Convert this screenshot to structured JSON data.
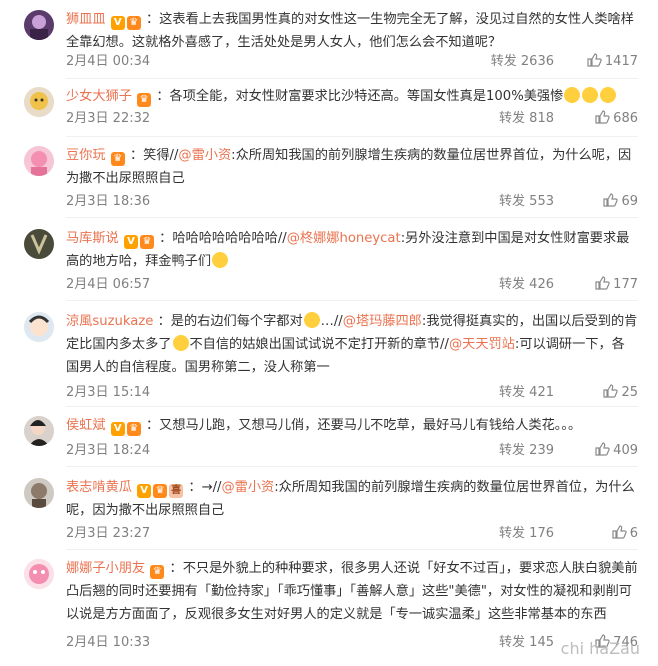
{
  "comments": [
    {
      "user": "狮皿皿",
      "text": "：这表看上去我国男性真的对女性这一生物完全无了解，没见过自然的女性人类啥样 全靠幻想。这就格外喜感了，生活处处是男人女人，他们怎么会不知道呢？",
      "time": "2月4日 00:34",
      "share": "转发 2636",
      "likes": "1417"
    },
    {
      "user": "少女大狮子",
      "text": "：各项全能，对女性财富要求比沙特还高。等国女性真是100%美强惨",
      "time": "2月3日 22:32",
      "share": "转发 818",
      "likes": "686"
    },
    {
      "user": "豆你玩",
      "text_a": "：笑得//",
      "mention_1": "@雷小资",
      "text_b": ":众所周知我国的前列腺增生疾病的数量位居世界首位，为什么呢，因为撒不出尿照照自己",
      "time": "2月3日 18:36",
      "share": "转发 553",
      "likes": "69"
    },
    {
      "user": "马库斯说",
      "text_a": "：哈哈哈哈哈哈哈哈//",
      "mention_1": "@柊娜娜honeycat",
      "text_b": ":另外没注意到中国是对女性财富要求最高的地方哈，拜金鸭子们",
      "time": "2月4日 06:57",
      "share": "转发 426",
      "likes": "177"
    },
    {
      "user": "涼風suzukaze",
      "text_a": "：是的右边们每个字都对",
      "text_a2": "…//",
      "mention_1": "@塔玛藤四郎",
      "text_b": ":我觉得挺真实的，出国以后受到的肯定比国内多太多了",
      "text_c": "不自信的姑娘出国试试说不定打开新的章节//",
      "mention_2": "@天天罚站",
      "text_d": ":可以调研一下，各国男人的自信程度。国男称第二，没人称第一",
      "time": "2月3日 15:14",
      "share": "转发 421",
      "likes": "25"
    },
    {
      "user": "侯虹斌",
      "text": "：又想马儿跑，又想马儿俏，还要马儿不吃草，最好马儿有钱给人类花。。。",
      "time": "2月3日 18:24",
      "share": "转发 239",
      "likes": "409"
    },
    {
      "user": "表志啃黄瓜",
      "text_a": "：→//",
      "mention_1": "@雷小资",
      "text_b": ":众所周知我国的前列腺增生疾病的数量位居世界首位，为什么呢，因为撒不出尿照照自己",
      "time": "2月3日 23:27",
      "share": "转发 176",
      "likes": "6"
    },
    {
      "user": "娜娜子小朋友",
      "text": "：不只是外貌上的种种要求，很多男人还说「好女不过百」，要求恋人肤白貌美前凸后翘的同时还要拥有「勤俭持家」「乖巧懂事」「善解人意」这些\"美德\"，对女性的凝视和剥削可以说是方方面面了，反观很多女生对好男人的定义就是「专一诚实温柔」这些非常基本的东西",
      "time": "2月4日 10:33",
      "share": "转发 145",
      "likes": "746"
    }
  ],
  "watermark": "chi haZau",
  "icons": {
    "like": "thumbs-up-icon",
    "verified": "v-badge-icon",
    "crown": "crown-badge-icon"
  },
  "colors": {
    "name": "#eb7350",
    "meta": "#808080",
    "verified": "#ffa200"
  }
}
